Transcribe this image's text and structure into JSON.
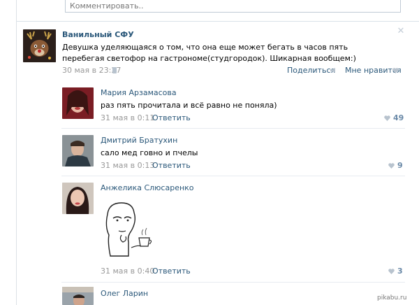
{
  "top": {
    "comment_placeholder": "Комментировать.."
  },
  "post": {
    "author": "Ванильный СФУ",
    "text": "Девушка уделяющаяся о том, что она еще может бегать в часов пять перебегая светофор на гастрономе(студгородок). Шикарная вообщем:)",
    "date": "30 мая в 23:27",
    "share_label": "Поделиться",
    "like_label": "Мне нравится",
    "close_icon": "close-icon",
    "colors": {
      "link": "#2b587a",
      "meta": "#999999",
      "like_count": "#6b8aa8"
    }
  },
  "comments": [
    {
      "author": "Мария Арзамасова",
      "text": "раз пять прочитала и всё равно не поняла)",
      "date": "31 мая в 0:11",
      "reply": "Ответить",
      "likes": "49"
    },
    {
      "author": "Дмитрий Братухин",
      "text": "сало мед говно и пчелы",
      "date": "31 мая в 0:13",
      "reply": "Ответить",
      "likes": "9"
    },
    {
      "author": "Анжелика Слюсаренко",
      "text": "",
      "sticker": "meme-face-sipping-tea",
      "date": "31 мая в 0:40",
      "reply": "Ответить",
      "likes": "3"
    },
    {
      "author": "Олег Ларин",
      "text": "",
      "date": "",
      "reply": "",
      "likes": ""
    }
  ],
  "watermark": "pikabu.ru"
}
